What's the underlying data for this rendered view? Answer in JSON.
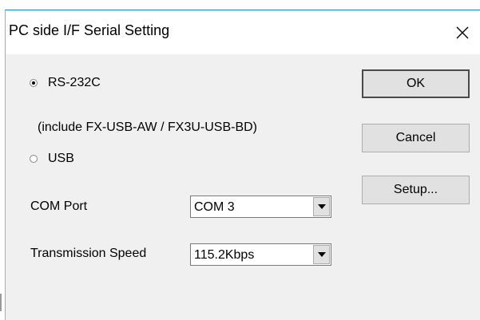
{
  "window": {
    "title": "PC side I/F Serial Setting"
  },
  "options": {
    "rs232c": {
      "label": "RS-232C",
      "checked": true
    },
    "rs232c_note": "(include FX-USB-AW / FX3U-USB-BD)",
    "usb": {
      "label": "USB",
      "checked": false
    }
  },
  "com_port": {
    "label": "COM Port",
    "value": "COM 3"
  },
  "transmission_speed": {
    "label": "Transmission Speed",
    "value": "115.2Kbps"
  },
  "buttons": {
    "ok": "OK",
    "cancel": "Cancel",
    "setup": "Setup..."
  },
  "icons": {
    "close": "close-icon",
    "dropdown": "chevron-down-icon"
  }
}
